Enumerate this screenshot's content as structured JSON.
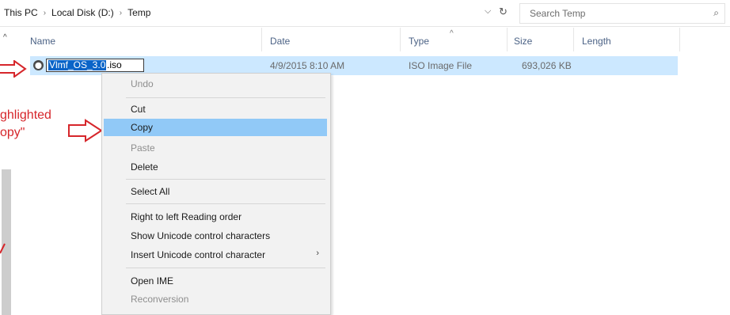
{
  "breadcrumb": {
    "items": [
      "This PC",
      "Local Disk (D:)",
      "Temp"
    ],
    "separator": "›"
  },
  "address_dropdown_icon": "⌵",
  "refresh_icon": "↻",
  "search": {
    "placeholder": "Search Temp",
    "icon": "⌕"
  },
  "columns": {
    "sort_up": "^",
    "name": "Name",
    "date": "Date",
    "type": "Type",
    "size": "Size",
    "length": "Length"
  },
  "file": {
    "icon": "⬤",
    "rename_selected": "Vlmf_OS_3.0",
    "rename_rest": ".iso",
    "date": "4/9/2015 8:10 AM",
    "type": "ISO Image File",
    "size": "693,026 KB"
  },
  "annotation": {
    "line1": "ghlighted",
    "line2": "opy\""
  },
  "context_menu": {
    "undo": "Undo",
    "cut": "Cut",
    "copy": "Copy",
    "paste": "Paste",
    "delete": "Delete",
    "select_all": "Select All",
    "rtl": "Right to left Reading order",
    "show_unicode": "Show Unicode control characters",
    "insert_unicode": "Insert Unicode control character",
    "submenu_arrow": "›",
    "open_ime": "Open IME",
    "reconversion": "Reconversion"
  },
  "colors": {
    "accent": "#0a64c8",
    "row_selected": "#cce8ff",
    "menu_highlight": "#91c9f7",
    "annotation": "#d6262b"
  }
}
